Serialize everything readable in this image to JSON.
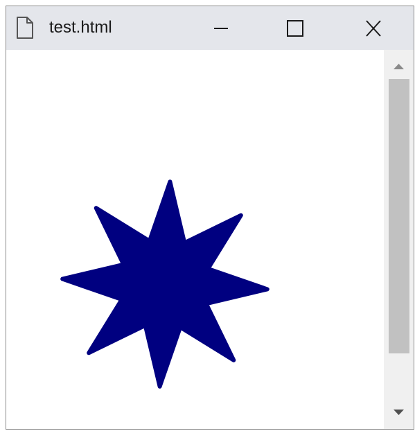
{
  "window": {
    "title": "test.html",
    "icons": {
      "document": "document-icon",
      "minimize": "minimize-icon",
      "maximize": "maximize-icon",
      "close": "close-icon"
    }
  },
  "content": {
    "shape": "eight-point-star",
    "fill_color": "#000080"
  },
  "scrollbar": {
    "icons": {
      "up": "scroll-up-arrow-icon",
      "down": "scroll-down-arrow-icon"
    },
    "thumb_color": "#c1c1c1",
    "track_color": "#f0f0f0"
  },
  "colors": {
    "titlebar": "#e4e6eb",
    "border": "#8a8a8a"
  }
}
